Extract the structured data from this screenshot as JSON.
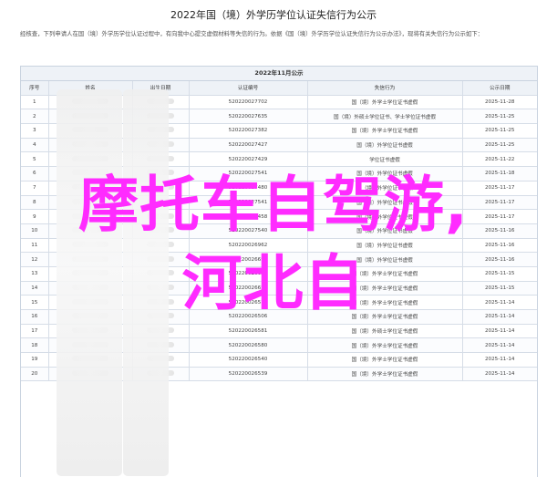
{
  "page": {
    "title": "2022年国（境）外学历学位认证失信行为公示",
    "intro": "经核查，下列申请人在国（境）外学历学位认证过程中，有向我中心提交虚假材料等失信的行为。依据《国（境）外学历学位认证失信行为公示办法》，现将有关失信行为公示如下："
  },
  "table": {
    "title": "2022年11月公示",
    "headers": [
      "序号",
      "姓名",
      "出生日期",
      "认证编号",
      "失信行为",
      "公示日期"
    ],
    "rows": [
      {
        "no": "1",
        "cert": "520220027702",
        "behavior": "国（境）外学士学位证书虚假",
        "date": "2025-11-28"
      },
      {
        "no": "2",
        "cert": "520220027635",
        "behavior": "国（境）外硕士学位证书、学士学位证书虚假",
        "date": "2025-11-25"
      },
      {
        "no": "3",
        "cert": "520220027382",
        "behavior": "国（境）外学士学位证书虚假",
        "date": "2025-11-25"
      },
      {
        "no": "4",
        "cert": "520220027427",
        "behavior": "国（境）外学位证书虚假",
        "date": "2025-11-25"
      },
      {
        "no": "5",
        "cert": "520220027429",
        "behavior": "学位证书虚假",
        "date": "2025-11-22"
      },
      {
        "no": "6",
        "cert": "520220027541",
        "behavior": "国（境）外学位证书虚假",
        "date": "2025-11-18"
      },
      {
        "no": "7",
        "cert": "520220027480",
        "behavior": "国（境）外学位证书虚假",
        "date": "2025-11-17"
      },
      {
        "no": "8",
        "cert": "520220027541",
        "behavior": "国（境）外学位证书虚假",
        "date": "2025-11-17"
      },
      {
        "no": "9",
        "cert": "520220027458",
        "behavior": "国（境）外学位证书虚假",
        "date": "2025-11-17"
      },
      {
        "no": "10",
        "cert": "520220027540",
        "behavior": "国（境）外学位证书虚假",
        "date": "2025-11-16"
      },
      {
        "no": "11",
        "cert": "520220026962",
        "behavior": "国（境）外学位证书虚假",
        "date": "2025-11-16"
      },
      {
        "no": "12",
        "cert": "520220026695",
        "behavior": "国（境）外学位证书虚假",
        "date": "2025-11-16"
      },
      {
        "no": "13",
        "cert": "520220026658",
        "behavior": "国（境）外学士学位证书虚假",
        "date": "2025-11-15"
      },
      {
        "no": "14",
        "cert": "520220026652",
        "behavior": "国（境）外学士学位证书虚假",
        "date": "2025-11-15"
      },
      {
        "no": "15",
        "cert": "520220026578",
        "behavior": "国（境）外学士学位证书虚假",
        "date": "2025-11-14"
      },
      {
        "no": "16",
        "cert": "520220026506",
        "behavior": "国（境）外学士学位证书虚假",
        "date": "2025-11-14"
      },
      {
        "no": "17",
        "cert": "520220026581",
        "behavior": "国（境）外硕士学位证书虚假",
        "date": "2025-11-14"
      },
      {
        "no": "18",
        "cert": "520220026580",
        "behavior": "国（境）外学士学位证书虚假",
        "date": "2025-11-14"
      },
      {
        "no": "19",
        "cert": "520220026540",
        "behavior": "国（境）外学士学位证书虚假",
        "date": "2025-11-14"
      },
      {
        "no": "20",
        "cert": "520220026539",
        "behavior": "国（境）外学士学位证书虚假",
        "date": "2025-11-14"
      }
    ]
  },
  "overlay": {
    "line1": "摩托车自驾游,",
    "line2": "河北自"
  },
  "colors": {
    "overlay": "#ff2bff",
    "header_bg": "#eef2f7",
    "border": "#c9d3e0"
  }
}
